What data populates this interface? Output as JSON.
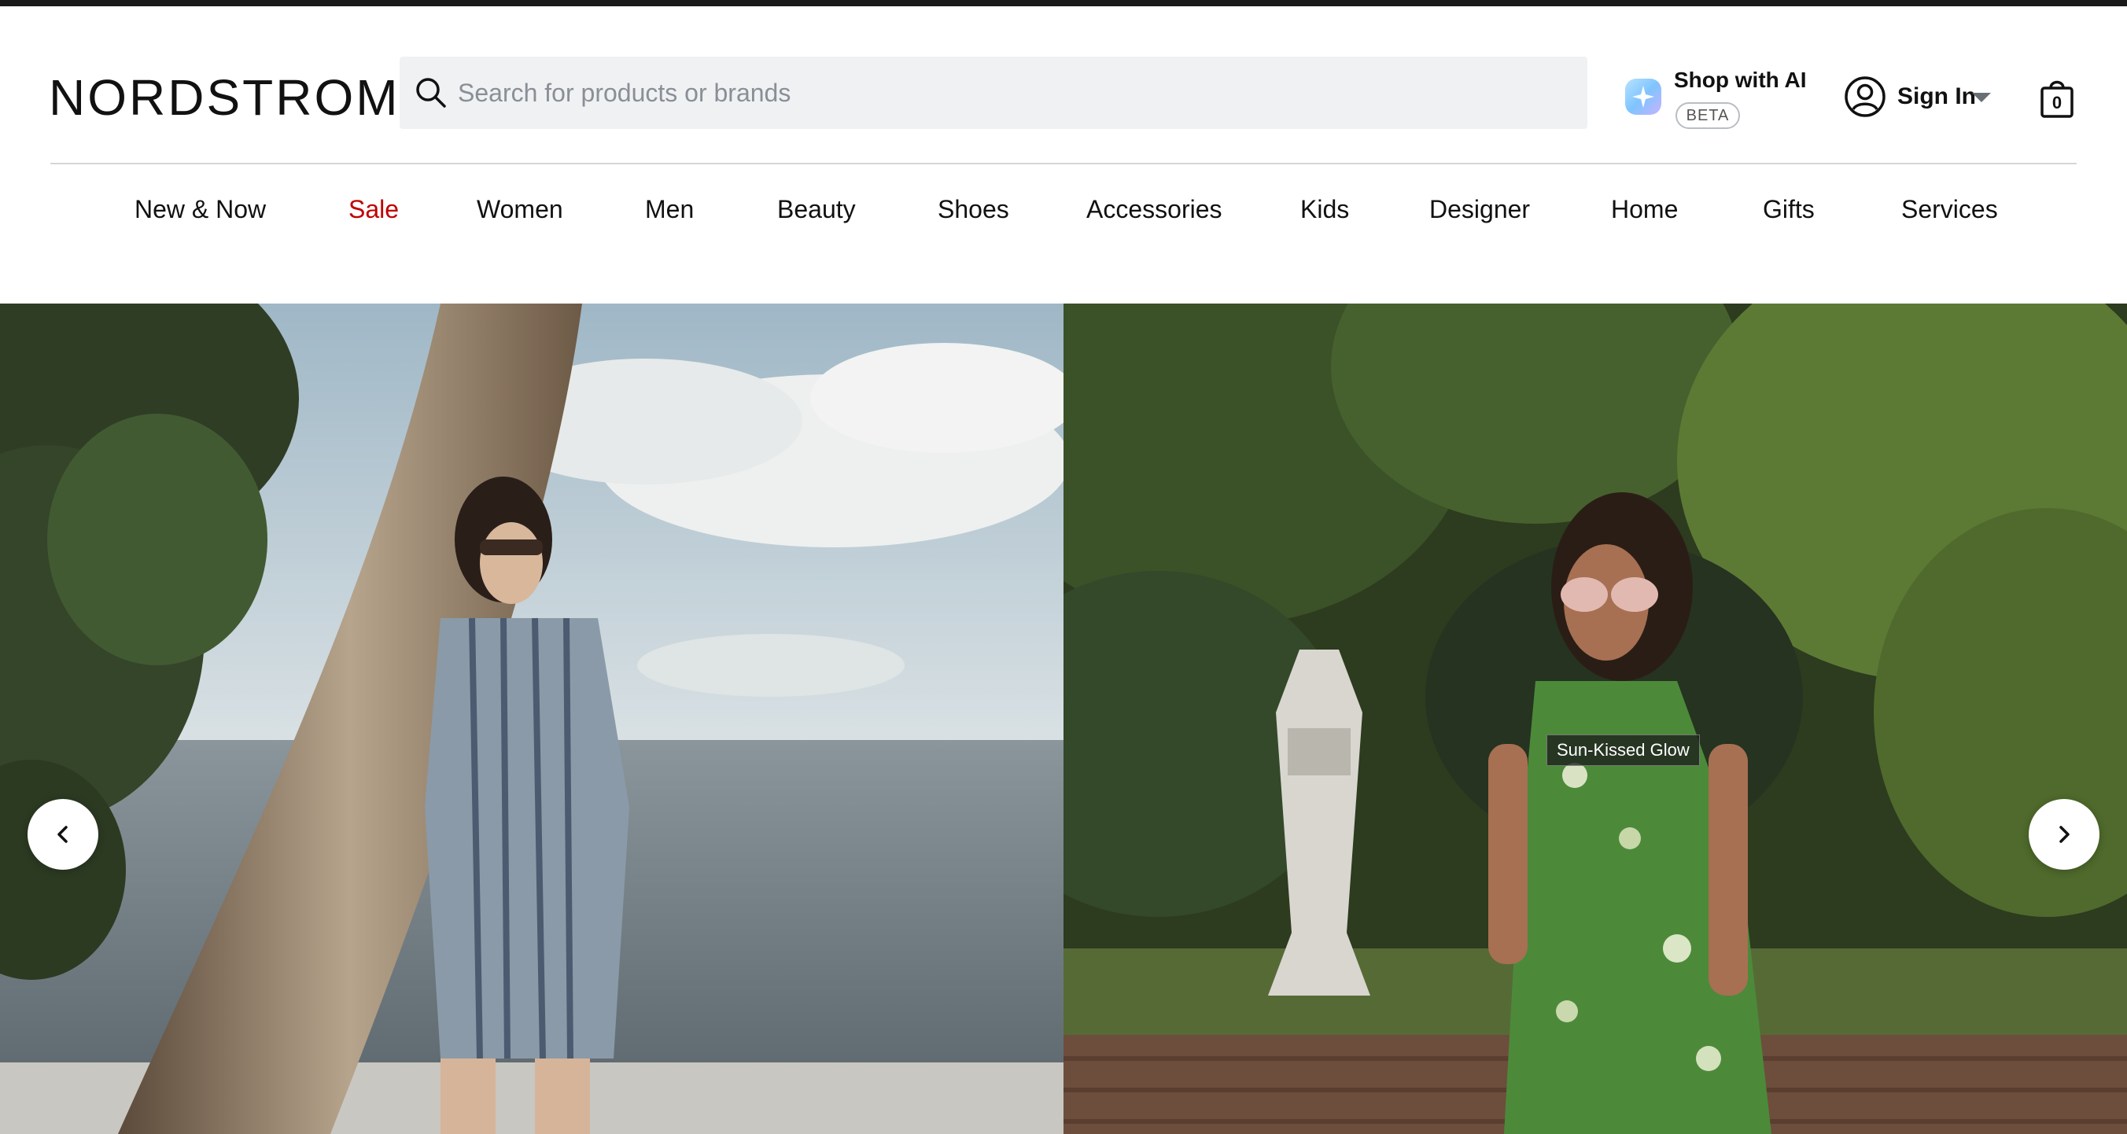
{
  "brand": {
    "logo_text": "NORDSTROM"
  },
  "search": {
    "placeholder": "Search for products or brands",
    "value": ""
  },
  "shop_ai": {
    "label": "Shop with AI",
    "badge": "BETA",
    "icon": "sparkle-icon"
  },
  "account": {
    "label": "Sign In",
    "icon": "user-circle-icon",
    "caret_icon": "caret-down-icon"
  },
  "bag": {
    "count": "0",
    "icon": "shopping-bag-icon"
  },
  "nav": {
    "items": [
      {
        "label": "New & Now"
      },
      {
        "label": "Sale",
        "color": "#c00000"
      },
      {
        "label": "Women"
      },
      {
        "label": "Men"
      },
      {
        "label": "Beauty"
      },
      {
        "label": "Shoes"
      },
      {
        "label": "Accessories"
      },
      {
        "label": "Kids"
      },
      {
        "label": "Designer"
      },
      {
        "label": "Home"
      },
      {
        "label": "Gifts"
      },
      {
        "label": "Services"
      }
    ]
  },
  "hero": {
    "slides": [
      {
        "description_icon": "beach-photo"
      },
      {
        "description_icon": "garden-photo",
        "tag": "Sun-Kissed Glow"
      }
    ],
    "prev_icon": "chevron-left-icon",
    "next_icon": "chevron-right-icon"
  },
  "colors": {
    "top_bar": "#1a1a1a",
    "search_bg": "#eff1f3",
    "sale_red": "#c00000",
    "divider": "#d4d6d9"
  }
}
